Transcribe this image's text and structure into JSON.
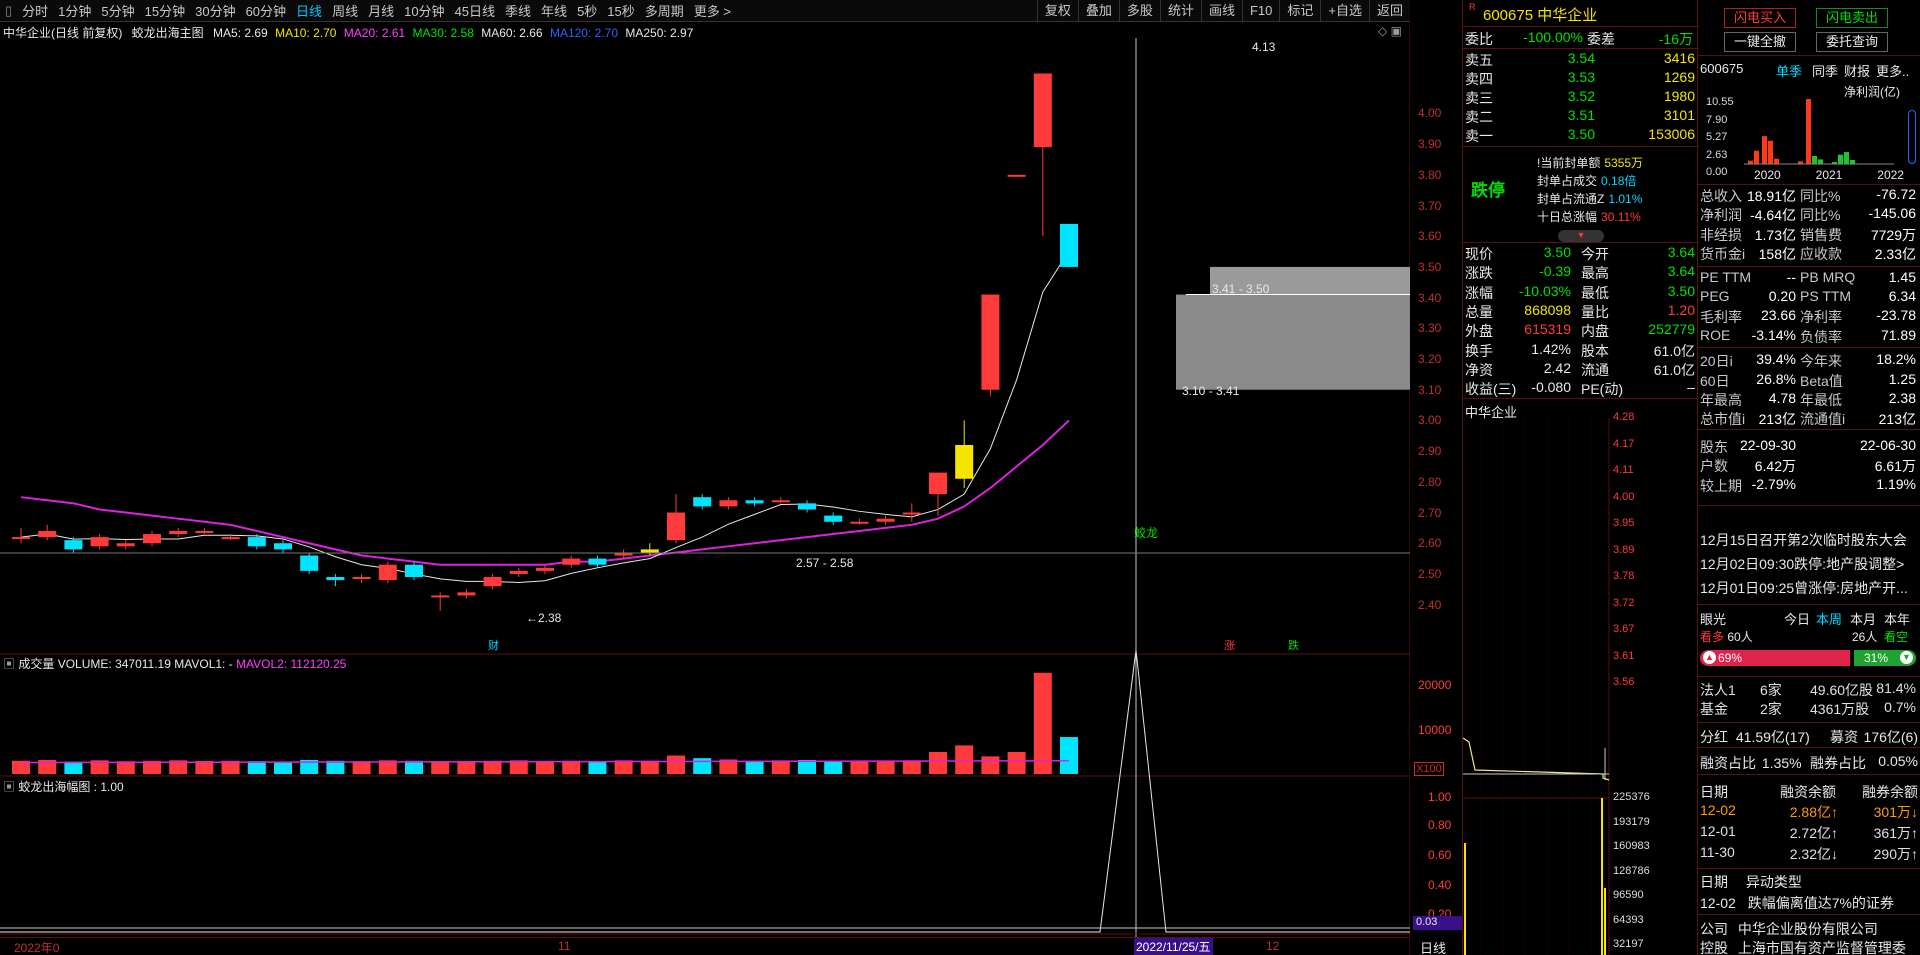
{
  "periods": [
    "分时",
    "1分钟",
    "5分钟",
    "15分钟",
    "30分钟",
    "60分钟",
    "日线",
    "周线",
    "月线",
    "10分钟",
    "45日线",
    "季线",
    "年线",
    "5秒",
    "15秒",
    "多周期",
    "更多 >"
  ],
  "active_period": "日线",
  "tools": [
    "复权",
    "叠加",
    "多股",
    "统计",
    "画线",
    "F10",
    "标记",
    "+自选",
    "返回"
  ],
  "main_legend": {
    "title": "中华企业(日线 前复权)",
    "indicator": "蛟龙出海主图",
    "ma5": "MA5: 2.69",
    "ma10": "MA10: 2.70",
    "ma20": "MA20: 2.61",
    "ma30": "MA30: 2.58",
    "ma60": "MA60: 2.66",
    "ma120": "MA120: 2.70",
    "ma250": "MA250: 2.97"
  },
  "price_axis": [
    "4.00",
    "3.90",
    "3.80",
    "3.70",
    "3.60",
    "3.50",
    "3.40",
    "3.30",
    "3.20",
    "3.10",
    "3.00",
    "2.90",
    "2.80",
    "2.70",
    "2.60",
    "2.50",
    "2.40"
  ],
  "annotations": {
    "high": "4.13",
    "low": "←2.38",
    "zone1": "2.57 - 2.58",
    "zone2": "3.41 - 3.50",
    "zone3": "3.10 - 3.41",
    "signal": "蛟龙",
    "cai": "财",
    "zhang": "涨",
    "die": "跌"
  },
  "volume": {
    "title": "成交量",
    "vol": "VOLUME: 347011.19",
    "mavol1": "MAVOL1: -",
    "mavol2": "MAVOL2: 112120.25",
    "axis": [
      "20000",
      "10000"
    ],
    "unit": "X100"
  },
  "sub": {
    "title": "蛟龙出海幅图 : 1.00",
    "axis": [
      "1.00",
      "0.80",
      "0.60",
      "0.40",
      "0.20"
    ],
    "value": "0.03"
  },
  "date_axis": {
    "d1": "2022年0",
    "d2": "11",
    "cursor": "2022/11/25/五",
    "d4": "12",
    "label": "日线"
  },
  "quote": {
    "code": "600675",
    "name": "中华企业",
    "r_tag": "R",
    "weibi_lbl": "委比",
    "weibi": "-100.00%",
    "weicha_lbl": "委差",
    "weicha": "-16万",
    "sell": [
      [
        "卖五",
        "3.54",
        "3416"
      ],
      [
        "卖四",
        "3.53",
        "1269"
      ],
      [
        "卖三",
        "3.52",
        "1980"
      ],
      [
        "卖二",
        "3.51",
        "3101"
      ],
      [
        "卖一",
        "3.50",
        "153006"
      ]
    ],
    "status": "跌停",
    "seal": [
      [
        "!当前封单额",
        "5355万"
      ],
      [
        "封单占成交",
        "0.18倍"
      ],
      [
        "封单占流通Z",
        "1.01%"
      ],
      [
        "十日总涨幅",
        "30.11%"
      ]
    ],
    "rows": [
      [
        "现价",
        "3.50",
        "今开",
        "3.64"
      ],
      [
        "涨跌",
        "-0.39",
        "最高",
        "3.64"
      ],
      [
        "涨幅",
        "-10.03%",
        "最低",
        "3.50"
      ],
      [
        "总量",
        "868098",
        "量比",
        "1.20"
      ],
      [
        "外盘",
        "615319",
        "内盘",
        "252779"
      ],
      [
        "换手",
        "1.42%",
        "股本",
        "61.0亿"
      ],
      [
        "净资",
        "2.42",
        "流通",
        "61.0亿"
      ],
      [
        "收益(三)",
        "-0.080",
        "PE(动)",
        "–"
      ]
    ],
    "mini_title": "中华企业",
    "mini_axis": [
      "4.28",
      "4.17",
      "4.11",
      "4.00",
      "3.95",
      "3.89",
      "3.78",
      "3.72",
      "3.67",
      "3.61",
      "3.56",
      "225376",
      "193179",
      "160983",
      "128786",
      "96590",
      "64393",
      "32197"
    ]
  },
  "fin": {
    "btn_buy": "闪电买入",
    "btn_sell": "闪电卖出",
    "btn_clear": "一键全撤",
    "btn_query": "委托查询",
    "code": "600675",
    "tabs": [
      "单季",
      "同季",
      "财报",
      "更多.."
    ],
    "chart_label": "净利润(亿)",
    "yaxis": [
      "10.55",
      "7.90",
      "5.27",
      "2.63",
      "0.00"
    ],
    "years": [
      "2020",
      "2021",
      "2022"
    ],
    "rows": [
      [
        "总收入",
        "18.91亿",
        "同比%",
        "-76.72"
      ],
      [
        "净利润",
        "-4.64亿",
        "同比%",
        "-145.06"
      ],
      [
        "非经损",
        "1.73亿",
        "销售费",
        "7729万"
      ],
      [
        "货币金i",
        "158亿",
        "应收款",
        "2.33亿"
      ],
      [
        "PE TTM",
        "--",
        "PB MRQ",
        "1.45"
      ],
      [
        "PEG",
        "0.20",
        "PS TTM",
        "6.34"
      ],
      [
        "毛利率",
        "23.66",
        "净利率",
        "-23.78"
      ],
      [
        "ROE",
        "-3.14%",
        "负债率",
        "71.89"
      ],
      [
        "20日i",
        "39.4%",
        "今年来",
        "18.2%"
      ],
      [
        "60日",
        "26.8%",
        "Beta值",
        "1.25"
      ],
      [
        "年最高",
        "4.78",
        "年最低",
        "2.38"
      ],
      [
        "总市值i",
        "213亿",
        "流通值i",
        "213亿"
      ],
      [
        "股东",
        "22-09-30",
        "",
        "22-06-30"
      ],
      [
        "户数",
        "6.42万",
        "",
        "6.61万"
      ],
      [
        "较上期",
        "-2.79%",
        "",
        "1.19%"
      ]
    ],
    "news": [
      "12月15日召开第2次临时股东大会",
      "12月02日09:30跌停:地产股调整>",
      "12月01日09:25曾涨停:房地产开..."
    ],
    "eye": {
      "label": "眼光",
      "periods": [
        "今日",
        "本周",
        "本月",
        "本年"
      ],
      "bull": "看多",
      "bull_n": "60人",
      "bear_n": "26人",
      "bear": "看空",
      "bull_pct": "69%",
      "bear_pct": "31%"
    },
    "inst": [
      [
        "法人1",
        "6家",
        "49.60亿股",
        "81.4%"
      ],
      [
        "基金",
        "2家",
        "4361万股",
        "0.7%"
      ]
    ],
    "div": [
      "分红",
      "41.59亿(17)",
      "募资",
      "176亿(6)"
    ],
    "margin": [
      "融资占比",
      "1.35%",
      "融券占比",
      "0.05%"
    ],
    "mhead": [
      "日期",
      "融资余额",
      "融券余额"
    ],
    "mrows": [
      [
        "12-02",
        "2.88亿↑",
        "301万↓"
      ],
      [
        "12-01",
        "2.72亿↑",
        "361万↑"
      ],
      [
        "11-30",
        "2.32亿↓",
        "290万↑"
      ]
    ],
    "abn_head": [
      "日期",
      "异动类型"
    ],
    "abn": [
      "12-02",
      "跌幅偏离值达7%的证券"
    ],
    "company": [
      "公司",
      "中华企业股份有限公司"
    ],
    "holder": [
      "控股",
      "上海市国有资产监督管理委"
    ]
  },
  "colors": {
    "up": "#ff3a3a",
    "down": "#00e5ff",
    "ma_purple": "#e020e0",
    "bg": "#000000"
  },
  "chart_data": {
    "type": "candlestick",
    "title": "中华企业(日线 前复权)",
    "candles": [
      [
        2.62,
        2.62,
        2.65,
        2.6
      ],
      [
        2.62,
        2.64,
        2.66,
        2.61
      ],
      [
        2.61,
        2.58,
        2.62,
        2.57
      ],
      [
        2.59,
        2.62,
        2.63,
        2.58
      ],
      [
        2.59,
        2.6,
        2.61,
        2.58
      ],
      [
        2.6,
        2.63,
        2.64,
        2.59
      ],
      [
        2.63,
        2.64,
        2.65,
        2.62
      ],
      [
        2.64,
        2.64,
        2.65,
        2.63
      ],
      [
        2.62,
        2.62,
        2.63,
        2.61
      ],
      [
        2.62,
        2.59,
        2.63,
        2.58
      ],
      [
        2.6,
        2.58,
        2.61,
        2.57
      ],
      [
        2.56,
        2.51,
        2.57,
        2.5
      ],
      [
        2.49,
        2.48,
        2.5,
        2.46
      ],
      [
        2.49,
        2.49,
        2.5,
        2.47
      ],
      [
        2.48,
        2.53,
        2.54,
        2.47
      ],
      [
        2.53,
        2.49,
        2.54,
        2.48
      ],
      [
        2.43,
        2.43,
        2.44,
        2.38
      ],
      [
        2.43,
        2.44,
        2.45,
        2.42
      ],
      [
        2.46,
        2.49,
        2.5,
        2.45
      ],
      [
        2.5,
        2.51,
        2.52,
        2.49
      ],
      [
        2.51,
        2.52,
        2.53,
        2.5
      ],
      [
        2.53,
        2.55,
        2.56,
        2.52
      ],
      [
        2.55,
        2.53,
        2.56,
        2.52
      ],
      [
        2.56,
        2.57,
        2.58,
        2.55
      ],
      [
        2.57,
        2.58,
        2.6,
        2.56
      ],
      [
        2.61,
        2.7,
        2.76,
        2.6
      ],
      [
        2.75,
        2.72,
        2.76,
        2.71
      ],
      [
        2.72,
        2.74,
        2.75,
        2.71
      ],
      [
        2.74,
        2.73,
        2.75,
        2.72
      ],
      [
        2.74,
        2.74,
        2.75,
        2.73
      ],
      [
        2.73,
        2.71,
        2.74,
        2.7
      ],
      [
        2.69,
        2.67,
        2.7,
        2.66
      ],
      [
        2.67,
        2.67,
        2.68,
        2.66
      ],
      [
        2.67,
        2.68,
        2.69,
        2.66
      ],
      [
        2.7,
        2.7,
        2.73,
        2.67
      ],
      [
        2.76,
        2.83,
        2.83,
        2.69
      ],
      [
        2.81,
        2.92,
        3.0,
        2.78
      ],
      [
        3.1,
        3.41,
        3.41,
        3.08
      ],
      [
        3.8,
        3.8,
        3.8,
        3.8
      ],
      [
        3.89,
        4.13,
        4.13,
        3.6
      ],
      [
        3.64,
        3.5,
        3.64,
        3.5
      ]
    ],
    "volume": [
      3000,
      3200,
      2800,
      3100,
      2900,
      3000,
      3100,
      2950,
      3000,
      2900,
      2800,
      3200,
      3000,
      2900,
      3100,
      3000,
      2900,
      2800,
      3000,
      3100,
      2900,
      3000,
      2950,
      3100,
      3000,
      4200,
      3600,
      3300,
      3000,
      3100,
      3200,
      3000,
      2900,
      3000,
      3100,
      5000,
      6500,
      4000,
      5000,
      23000,
      8400
    ],
    "ma_purple": [
      2.75,
      2.74,
      2.73,
      2.71,
      2.7,
      2.69,
      2.68,
      2.67,
      2.66,
      2.64,
      2.62,
      2.6,
      2.58,
      2.56,
      2.55,
      2.54,
      2.53,
      2.53,
      2.53,
      2.53,
      2.53,
      2.54,
      2.54,
      2.55,
      2.56,
      2.57,
      2.58,
      2.59,
      2.6,
      2.61,
      2.62,
      2.63,
      2.64,
      2.65,
      2.66,
      2.68,
      2.72,
      2.78,
      2.85,
      2.92,
      3.0
    ],
    "ylim": [
      2.35,
      4.2
    ]
  }
}
